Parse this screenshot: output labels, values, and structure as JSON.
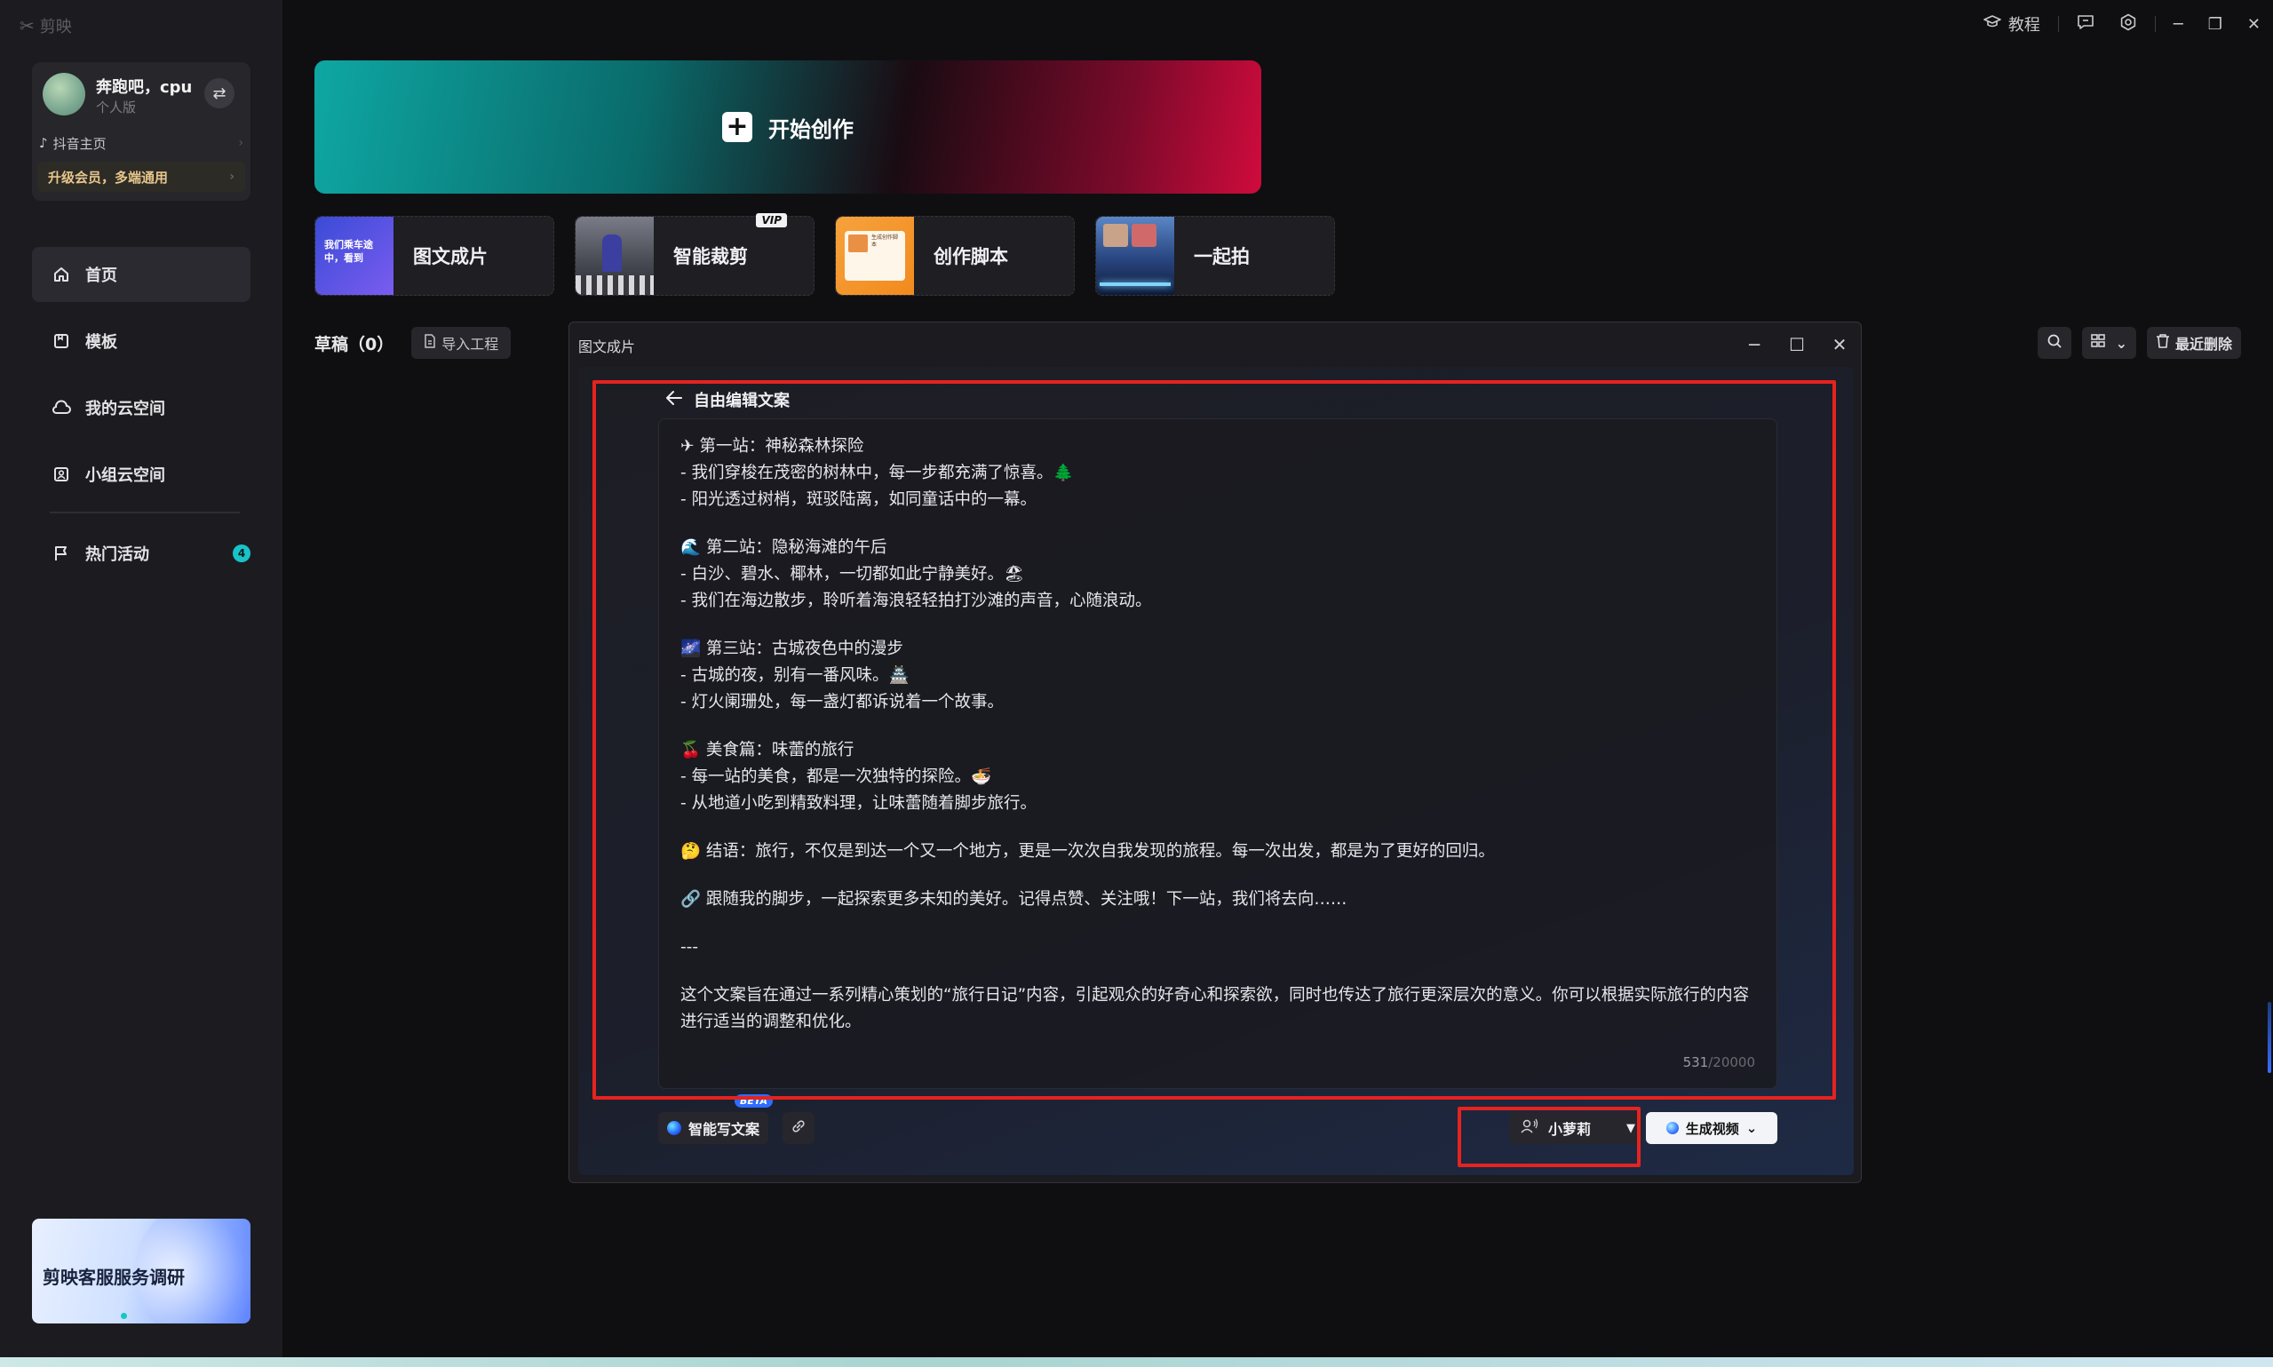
{
  "app": {
    "logo_text": "剪映"
  },
  "topbar": {
    "tutorial_label": "教程"
  },
  "user": {
    "name": "奔跑吧，cpu",
    "plan": "个人版",
    "douyin_label": "抖音主页",
    "upgrade_label": "升级会员，多端通用"
  },
  "nav": {
    "home": "首页",
    "templates": "模板",
    "my_cloud": "我的云空间",
    "team_cloud": "小组云空间",
    "hot_events": "热门活动",
    "hot_events_badge": "4"
  },
  "survey": {
    "label": "剪映客服服务调研"
  },
  "start": {
    "label": "开始创作"
  },
  "quick_actions": [
    {
      "label": "图文成片",
      "thumb_text": "我们乘车途中，看到"
    },
    {
      "label": "智能裁剪",
      "badge": "VIP"
    },
    {
      "label": "创作脚本",
      "thumb_text": "生成创作脚本"
    },
    {
      "label": "一起拍"
    }
  ],
  "drafts": {
    "label": "草稿（0）",
    "import_label": "导入工程"
  },
  "toolbar": {
    "recent_delete_label": "最近删除"
  },
  "dialog": {
    "title": "图文成片",
    "back_label": "自由编辑文案",
    "content": [
      "✈ 第一站：神秘森林探险",
      "- 我们穿梭在茂密的树林中，每一步都充满了惊喜。🌲",
      "- 阳光透过树梢，斑驳陆离，如同童话中的一幕。",
      "",
      "🌊 第二站：隐秘海滩的午后",
      "- 白沙、碧水、椰林，一切都如此宁静美好。🏖",
      "- 我们在海边散步，聆听着海浪轻轻拍打沙滩的声音，心随浪动。",
      "",
      "🌌 第三站：古城夜色中的漫步",
      "- 古城的夜，别有一番风味。🏯",
      "- 灯火阑珊处，每一盏灯都诉说着一个故事。",
      "",
      "🍒 美食篇：味蕾的旅行",
      "- 每一站的美食，都是一次独特的探险。🍜",
      "- 从地道小吃到精致料理，让味蕾随着脚步旅行。",
      "",
      "🤔 结语：旅行，不仅是到达一个又一个地方，更是一次次自我发现的旅程。每一次出发，都是为了更好的回归。",
      "",
      "🔗 跟随我的脚步，一起探索更多未知的美好。记得点赞、关注哦！下一站，我们将去向……",
      "",
      "---",
      "",
      "这个文案旨在通过一系列精心策划的“旅行日记”内容，引起观众的好奇心和探索欲，同时也传达了旅行更深层次的意义。你可以根据实际旅行的内容进行适当的调整和优化。"
    ],
    "char_count": "531",
    "char_max": "/20000",
    "ai_write_label": "智能写文案",
    "beta_label": "BETA",
    "voice_label": "小萝莉",
    "generate_label": "生成视频"
  },
  "colors": {
    "accent_teal": "#0ea7a3",
    "accent_red": "#cf0b3c",
    "annotation_red": "#e5231f",
    "badge_cyan": "#18c3c8"
  }
}
